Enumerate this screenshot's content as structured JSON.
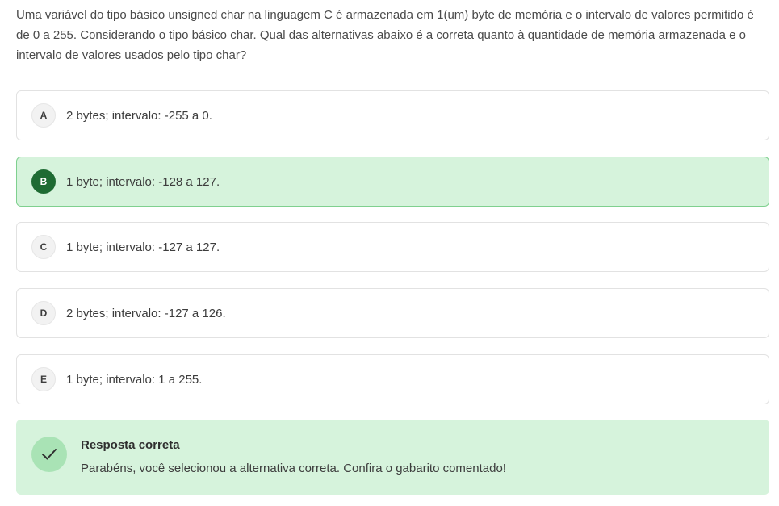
{
  "question": {
    "text": "Uma variável do tipo básico unsigned char na linguagem C é armazenada em 1(um) byte de memória e o intervalo de valores permitido é de 0 a 255. Considerando o tipo básico char. Qual das alternativas abaixo é a correta quanto à quantidade de memória armazenada e o intervalo de valores usados pelo tipo char?"
  },
  "options": [
    {
      "letter": "A",
      "text": "2 bytes; intervalo: -255 a 0."
    },
    {
      "letter": "B",
      "text": "1 byte; intervalo: -128 a 127."
    },
    {
      "letter": "C",
      "text": "1 byte; intervalo: -127 a 127."
    },
    {
      "letter": "D",
      "text": "2 bytes; intervalo: -127 a 126."
    },
    {
      "letter": "E",
      "text": "1 byte; intervalo: 1 a 255."
    }
  ],
  "selected_option": "B",
  "feedback": {
    "icon": "check-icon",
    "title": "Resposta correta",
    "message": "Parabéns, você selecionou a alternativa correta. Confira o gabarito comentado!"
  },
  "colors": {
    "correct_bg": "#d6f3dc",
    "correct_border": "#7fd08f",
    "correct_badge": "#1e6b33",
    "check_circle": "#a9e3b5"
  }
}
